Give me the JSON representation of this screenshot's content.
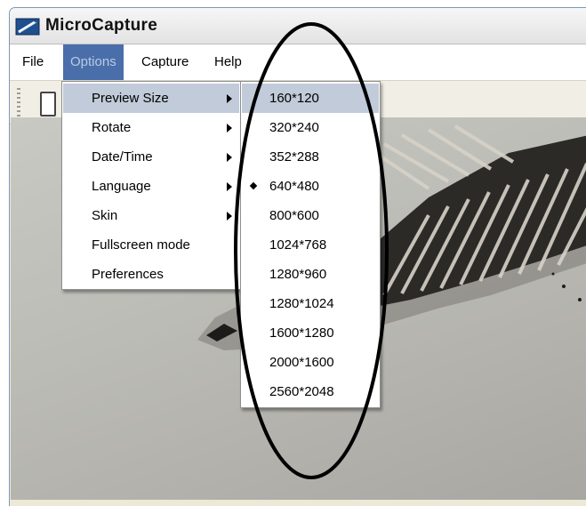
{
  "window": {
    "title": "MicroCapture"
  },
  "menubar": {
    "items": [
      {
        "label": "File",
        "active": false
      },
      {
        "label": "Options",
        "active": true
      },
      {
        "label": "Capture",
        "active": false
      },
      {
        "label": "Help",
        "active": false
      }
    ]
  },
  "options_menu": {
    "items": [
      {
        "label": "Preview Size",
        "has_submenu": true,
        "highlighted": true
      },
      {
        "label": "Rotate",
        "has_submenu": true
      },
      {
        "label": "Date/Time",
        "has_submenu": true
      },
      {
        "label": "Language",
        "has_submenu": true
      },
      {
        "label": "Skin",
        "has_submenu": true
      },
      {
        "label": "Fullscreen mode",
        "has_submenu": false
      },
      {
        "label": "Preferences",
        "has_submenu": false
      }
    ]
  },
  "preview_size_menu": {
    "items": [
      {
        "label": "160*120",
        "highlighted": true,
        "checked": false
      },
      {
        "label": "320*240",
        "checked": false
      },
      {
        "label": "352*288",
        "checked": false
      },
      {
        "label": "640*480",
        "checked": true
      },
      {
        "label": "800*600",
        "checked": false
      },
      {
        "label": "1024*768",
        "checked": false
      },
      {
        "label": "1280*960",
        "checked": false
      },
      {
        "label": "1280*1024",
        "checked": false
      },
      {
        "label": "1600*1280",
        "checked": false
      },
      {
        "label": "2000*1600",
        "checked": false
      },
      {
        "label": "2560*2048",
        "checked": false
      }
    ]
  },
  "colors": {
    "menu_active_bg": "#4a6ea9",
    "menu_highlight_bg": "#c1cbd9",
    "annotation": "#000000"
  }
}
